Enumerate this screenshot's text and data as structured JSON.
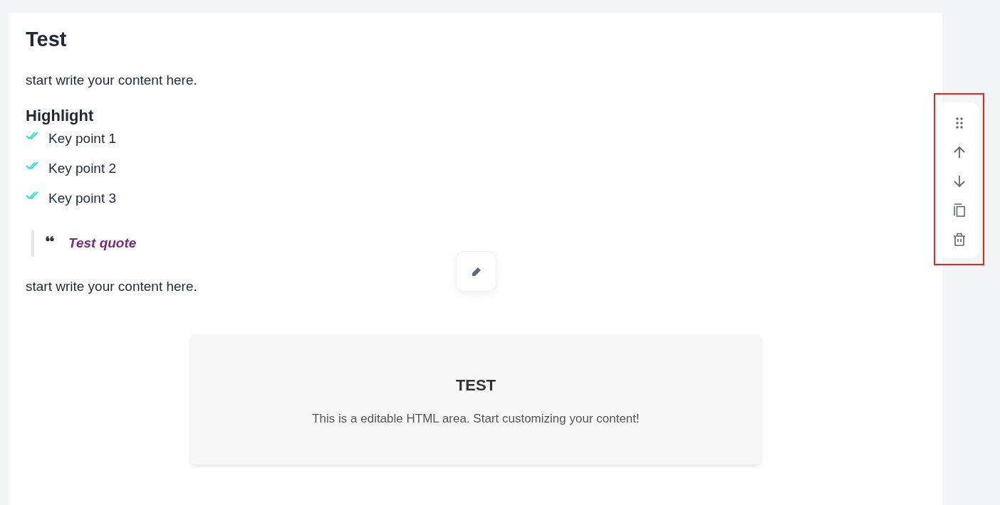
{
  "title": "Test",
  "intro": "start write your content here.",
  "highlight": {
    "heading": "Highlight",
    "points": [
      "Key point 1",
      "Key point 2",
      "Key point 3"
    ]
  },
  "quote": "Test quote",
  "outro": "start write your content here.",
  "html_area": {
    "title": "TEST",
    "text": "This is a editable HTML area. Start customizing your content!"
  }
}
